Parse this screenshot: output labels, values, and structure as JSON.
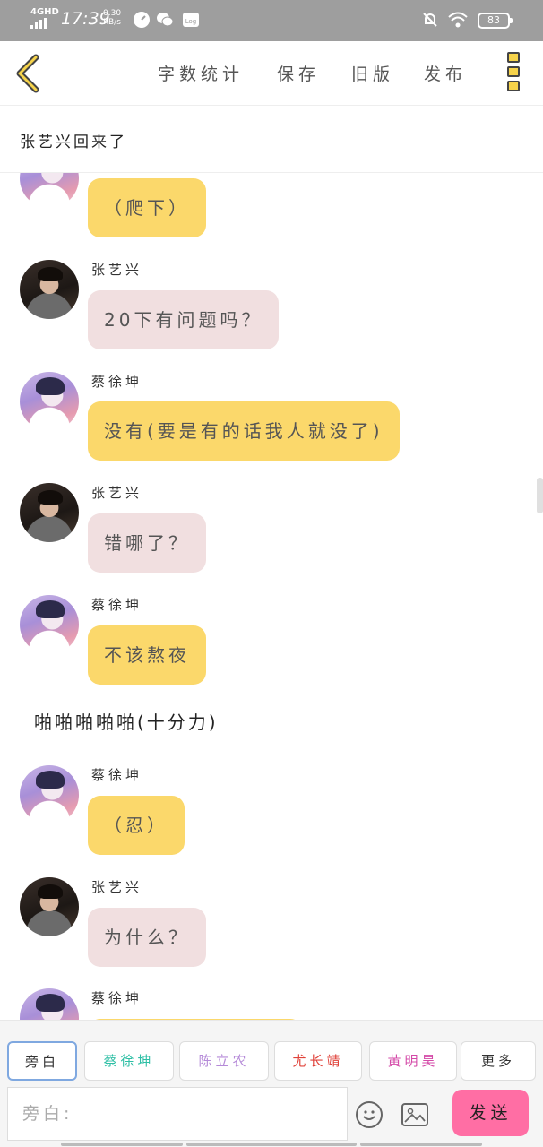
{
  "status_bar": {
    "network": "4GHD",
    "time": "17:39",
    "speed_value": "0.30",
    "speed_unit": "KB/s",
    "battery": "83"
  },
  "nav": {
    "back_icon": "chevron-left-icon",
    "actions": [
      "字数统计",
      "保存",
      "旧版",
      "发布"
    ],
    "more_icon": "more-vertical-icon",
    "accent": "#f6d34a"
  },
  "title": "张艺兴回来了",
  "messages": [
    {
      "type": "bubble",
      "speaker": "蔡徐坤",
      "text": "（爬下）",
      "color": "yellow"
    },
    {
      "type": "bubble",
      "speaker": "张艺兴",
      "text": "20下有问题吗？",
      "color": "pink"
    },
    {
      "type": "bubble",
      "speaker": "蔡徐坤",
      "text": "没有(要是有的话我人就没了)",
      "color": "yellow"
    },
    {
      "type": "bubble",
      "speaker": "张艺兴",
      "text": "错哪了？",
      "color": "pink"
    },
    {
      "type": "bubble",
      "speaker": "蔡徐坤",
      "text": "不该熬夜",
      "color": "yellow"
    },
    {
      "type": "narration",
      "text": "啪啪啪啪啪(十分力)"
    },
    {
      "type": "bubble",
      "speaker": "蔡徐坤",
      "text": "（忍）",
      "color": "yellow"
    },
    {
      "type": "bubble",
      "speaker": "张艺兴",
      "text": "为什么？",
      "color": "pink"
    },
    {
      "type": "bubble",
      "speaker": "蔡徐坤",
      "text": "",
      "color": "yellow"
    }
  ],
  "roles": [
    {
      "label": "旁白",
      "color": "#555555"
    },
    {
      "label": "蔡徐坤",
      "color": "#2ebfa5"
    },
    {
      "label": "陈立农",
      "color": "#b58ad8"
    },
    {
      "label": "尤长靖",
      "color": "#e0423a"
    },
    {
      "label": "黄明昊",
      "color": "#d44aa8"
    },
    {
      "label": "更多",
      "color": "#555555"
    }
  ],
  "composer": {
    "placeholder": "旁白:",
    "send_label": "发送",
    "send_color": "#ff6ea4"
  }
}
